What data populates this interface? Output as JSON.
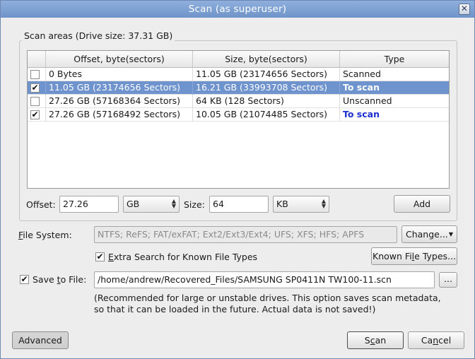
{
  "window": {
    "title": "Scan (as superuser)",
    "close_glyph": "✕"
  },
  "scan_areas": {
    "group_title": "Scan areas (Drive size: 37.31 GB)",
    "columns": [
      "Offset, byte(sectors)",
      "Size, byte(sectors)",
      "Type"
    ],
    "rows": [
      {
        "checked": false,
        "selected": false,
        "offset": "0 Bytes",
        "size": "11.05 GB (23174656 Sectors)",
        "type": "Scanned",
        "type_style": "normal"
      },
      {
        "checked": true,
        "selected": true,
        "offset": "11.05 GB (23174656 Sectors)",
        "size": "16.21 GB (33993708 Sectors)",
        "type": "To scan",
        "type_style": "to-scan"
      },
      {
        "checked": false,
        "selected": false,
        "offset": "27.26 GB (57168364 Sectors)",
        "size": "64 KB (128 Sectors)",
        "type": "Unscanned",
        "type_style": "normal"
      },
      {
        "checked": true,
        "selected": false,
        "offset": "27.26 GB (57168492 Sectors)",
        "size": "10.05 GB (21074485 Sectors)",
        "type": "To scan",
        "type_style": "to-scan"
      }
    ],
    "offset_label": "Offset:",
    "offset_value": "27.26",
    "offset_unit": "GB",
    "size_label": "Size:",
    "size_value": "64",
    "size_unit": "KB",
    "add_label": "Add"
  },
  "file_system": {
    "label_prefix": "F",
    "label_rest": "ile System:",
    "value": "NTFS; ReFS; FAT/exFAT; Ext2/Ext3/Ext4; UFS; XFS; HFS; APFS",
    "change_label": "Change...",
    "extra_search_checked": true,
    "extra_search_prefix": "E",
    "extra_search_rest": "xtra Search for Known File Types",
    "known_types_pre": "Known Fi",
    "known_types_ul": "l",
    "known_types_post": "e Types..."
  },
  "save": {
    "checked": true,
    "label_pre": "Save ",
    "label_ul": "t",
    "label_post": "o File:",
    "path": "/home/andrew/Recovered_Files/SAMSUNG SP0411N TW100-11.scn",
    "browse_label": "...",
    "note_line1": "(Recommended for large or unstable drives. This option saves scan metadata,",
    "note_line2": "so that it can be loaded in the future. Actual data is not saved!)"
  },
  "footer": {
    "advanced_label": "Advanced",
    "scan_pre": "S",
    "scan_ul": "c",
    "scan_post": "an",
    "cancel_pre": "Ca",
    "cancel_ul": "n",
    "cancel_post": "cel"
  },
  "colors": {
    "title_bar": "#7a9ad0",
    "selection": "#6e93cd",
    "to_scan_text": "#1c2fd1"
  }
}
